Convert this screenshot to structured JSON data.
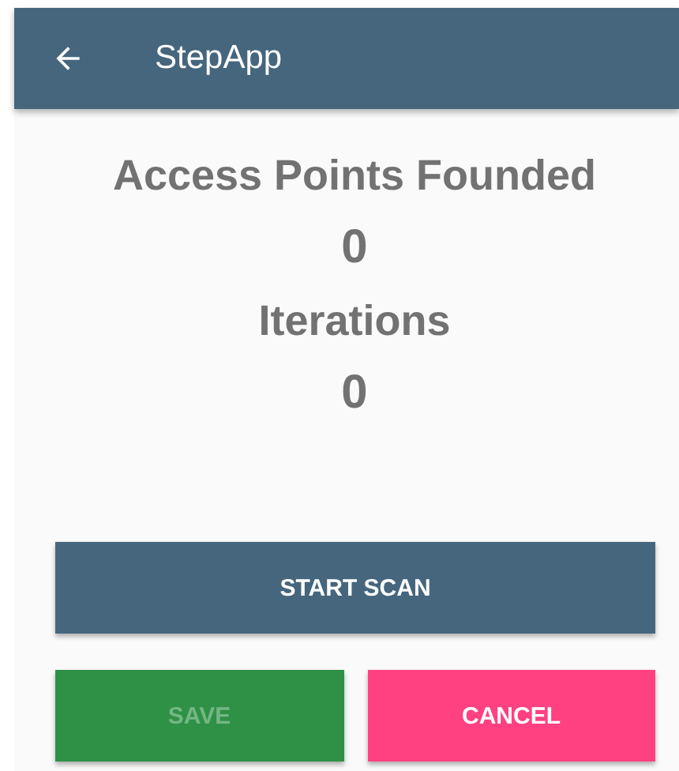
{
  "app_bar": {
    "title": "StepApp"
  },
  "stats": [
    {
      "label": "Access Points Founded",
      "value": "0"
    },
    {
      "label": "Iterations",
      "value": "0"
    }
  ],
  "start_button": {
    "label": "START SCAN",
    "disabled": false
  },
  "buttons": [
    {
      "label": "SAVE",
      "kind": "save",
      "disabled": true
    },
    {
      "label": "CANCEL",
      "kind": "cancel",
      "disabled": false
    }
  ]
}
